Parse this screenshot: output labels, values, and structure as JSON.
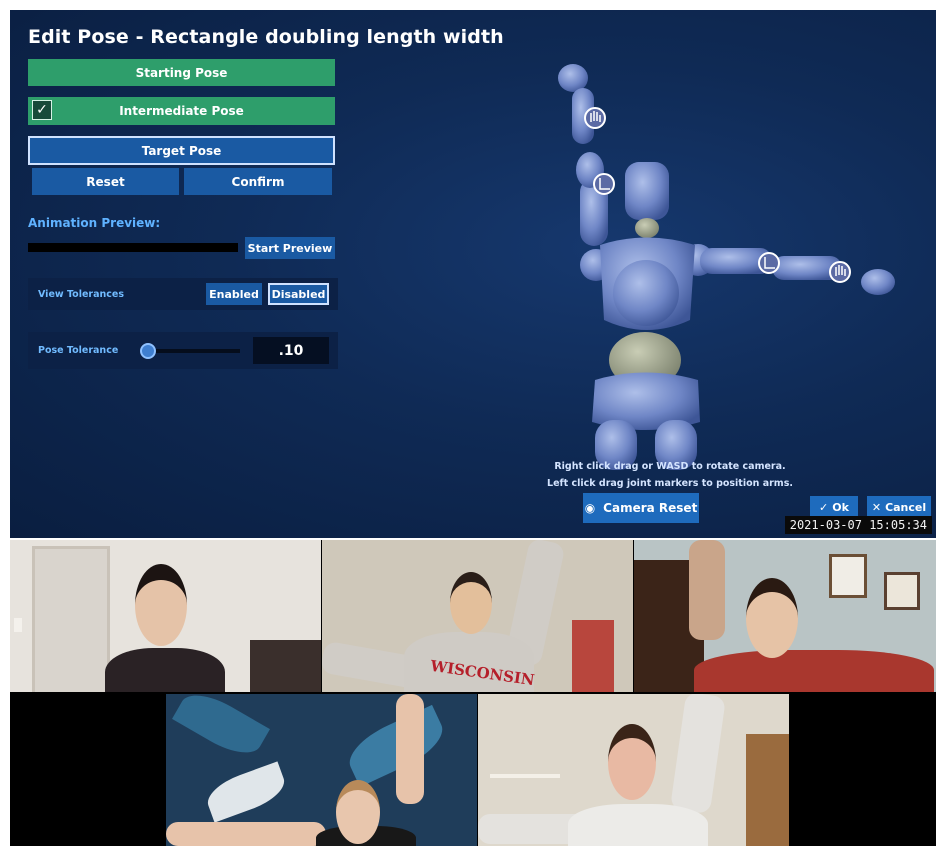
{
  "app": {
    "title": "Edit Pose - Rectangle doubling length width",
    "buttons": {
      "starting_pose": "Starting Pose",
      "intermediate_pose": "Intermediate Pose",
      "target_pose": "Target Pose",
      "reset": "Reset",
      "confirm": "Confirm",
      "start_preview": "Start Preview",
      "enabled": "Enabled",
      "disabled": "Disabled",
      "camera_reset": "Camera Reset",
      "ok": "Ok",
      "cancel": "Cancel"
    },
    "intermediate_checked": true,
    "animation_preview_label": "Animation Preview:",
    "view_tolerances_label": "View Tolerances",
    "view_tolerances_selected": "Disabled",
    "pose_tolerance_label": "Pose Tolerance",
    "pose_tolerance_value": ".10",
    "hint_line1": "Right click drag or WASD to rotate camera.",
    "hint_line2": "Left click drag joint markers to position arms."
  },
  "video": {
    "timestamp": "2021-03-07  15:05:34",
    "sweatshirt_text": "WISCONSIN"
  },
  "colors": {
    "green": "#2e9e6b",
    "blue": "#1a5aa3",
    "label_blue": "#5fb2ff",
    "background": "#0f2a55"
  },
  "icons": [
    "check-icon",
    "hand-joint-marker-icon",
    "eye-icon",
    "checkmark-icon",
    "x-icon"
  ]
}
